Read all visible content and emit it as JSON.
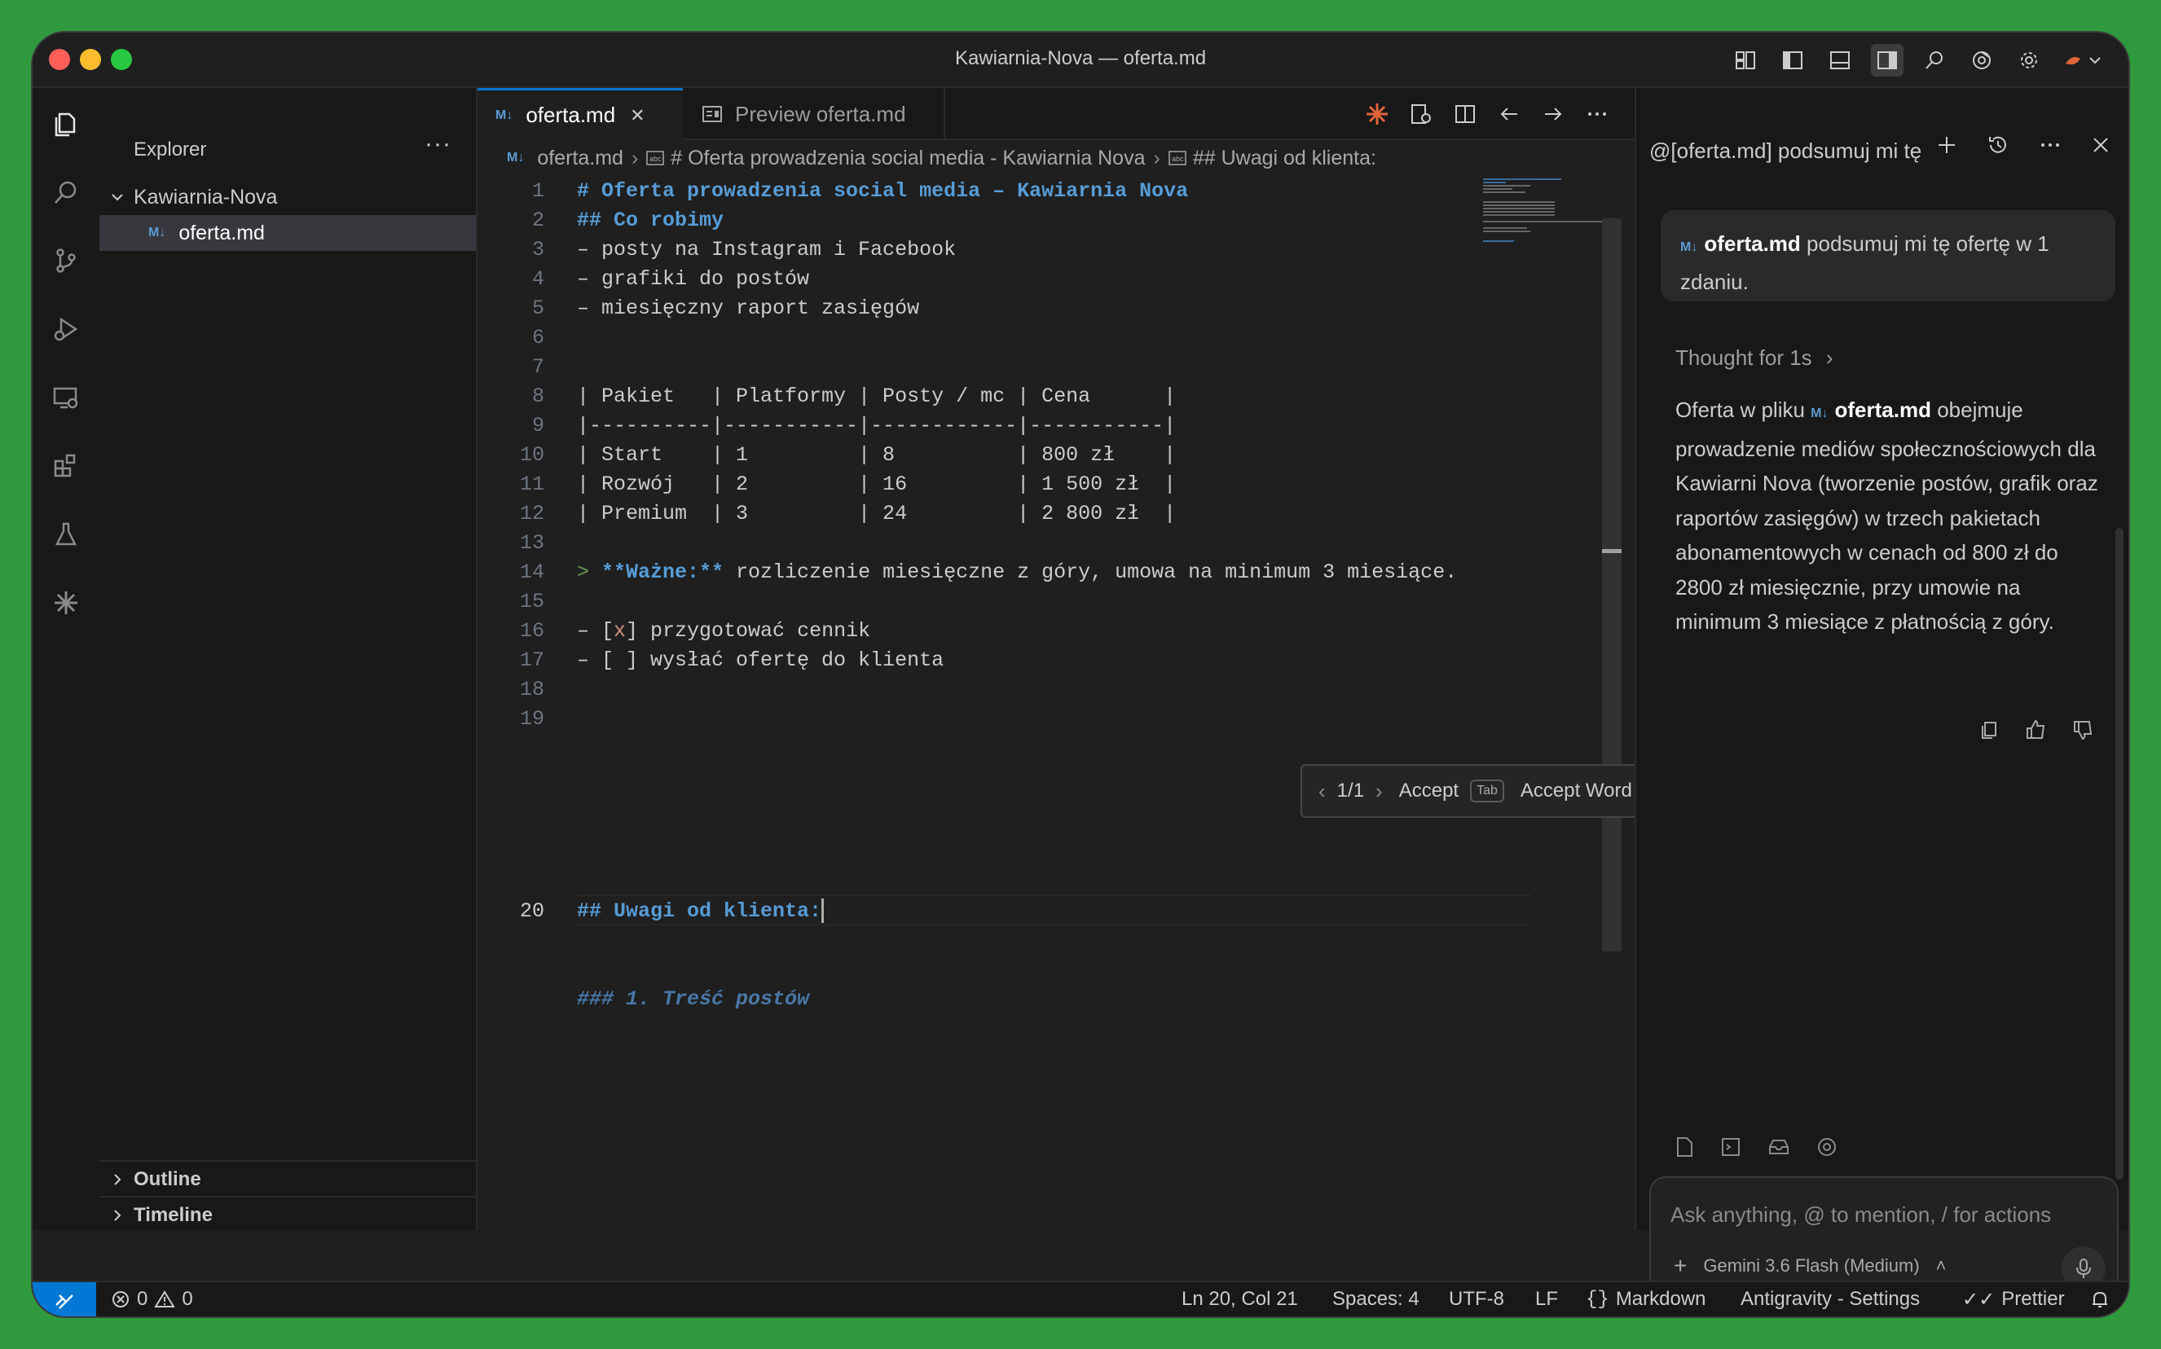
{
  "window": {
    "title": "Kawiarnia-Nova — oferta.md"
  },
  "sidebar": {
    "title": "Explorer",
    "more": "···",
    "folder": "Kawiarnia-Nova",
    "file_badge": "M↓",
    "file": "oferta.md",
    "outline": "Outline",
    "timeline": "Timeline"
  },
  "tabs": [
    {
      "badge": "M↓",
      "label": "oferta.md",
      "close": "✕"
    },
    {
      "label": "Preview oferta.md"
    }
  ],
  "breadcrumb": {
    "badge": "M↓",
    "file": "oferta.md",
    "h1": "# Oferta prowadzenia social media - Kawiarnia Nova",
    "h2": "## Uwagi od klienta:"
  },
  "code": {
    "line_numbers": [
      "1",
      "2",
      "3",
      "4",
      "5",
      "6",
      "7",
      "8",
      "9",
      "10",
      "11",
      "12",
      "13",
      "14",
      "15",
      "16",
      "17",
      "18",
      "19",
      "20"
    ],
    "l1": "# Oferta prowadzenia social media – Kawiarnia Nova",
    "l2": "## Co robimy",
    "l3": "– posty na Instagram i Facebook",
    "l4": "– grafiki do postów",
    "l5": "– miesięczny raport zasięgów",
    "l8": "| Pakiet   | Platformy | Posty / mc | Cena      |",
    "l9": "|----------|-----------|------------|-----------|",
    "l10": "| Start    | 1         | 8          | 800 zł    |",
    "l11": "| Rozwój   | 2         | 16         | 1 500 zł  |",
    "l12": "| Premium  | 3         | 24         | 2 800 zł  |",
    "l14_prefix": "> ",
    "l14_bold": "**Ważne:**",
    "l14_rest": " rozliczenie miesięczne z góry, umowa na minimum 3 miesiące.",
    "l16_a": "– [",
    "l16_x": "x",
    "l16_b": "] przygotować cennik",
    "l17": "– [ ] wysłać ofertę do klienta",
    "l20": "## Uwagi od klienta:",
    "ghost": "### 1. Treść postów"
  },
  "suggest": {
    "counter": "1/1",
    "accept": "Accept",
    "accept_key": "Tab",
    "accept_word": "Accept Word",
    "word_key1": "⌘",
    "word_key2": "→",
    "more": "···"
  },
  "chat": {
    "title": "@[oferta.md] podsumuj mi tę",
    "user_badge": "M↓",
    "user_file": "oferta.md",
    "user_text": " podsumuj mi tę ofertę w 1 zdaniu.",
    "thought": "Thought for 1s",
    "answer_pre": "Oferta w pliku ",
    "answer_badge": "M↓",
    "answer_file": "oferta.md",
    "answer_post": " obejmuje prowadzenie mediów społecznościowych dla Kawiarni Nova (tworzenie postów, grafik oraz raportów zasięgów) w trzech pakietach abonamentowych w cenach od 800 zł do 2800 zł miesięcznie, przy umowie na minimum 3 miesiące z płatnością z góry.",
    "input_placeholder": "Ask anything, @ to mention, / for actions",
    "model": "Gemini 3.6 Flash (Medium)"
  },
  "status": {
    "errors": "0",
    "warnings": "0",
    "position": "Ln 20, Col 21",
    "spaces": "Spaces: 4",
    "encoding": "UTF-8",
    "eol": "LF",
    "language": "Markdown",
    "settings": "Antigravity - Settings",
    "prettier": "Prettier"
  },
  "colors": {
    "accent": "#0078d4",
    "heading": "#569cd6",
    "quote": "#6a9955",
    "background": "#1f1f1f",
    "desktop": "#2f9a3d"
  }
}
